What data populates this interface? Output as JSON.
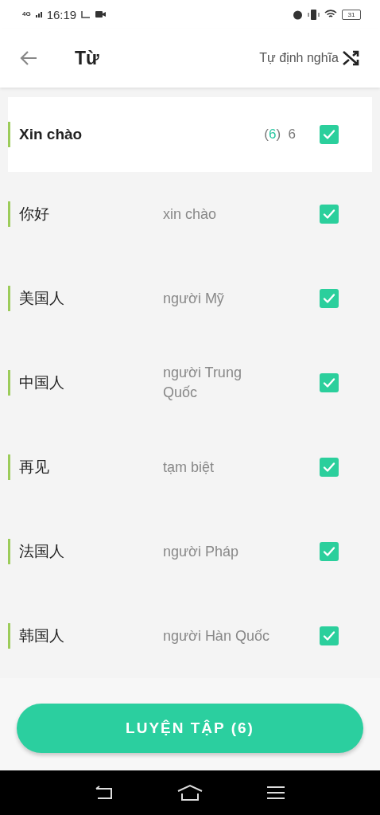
{
  "status_bar": {
    "network": "4G",
    "time": "16:19",
    "battery": "31"
  },
  "header": {
    "title": "Từ",
    "action": "Tự định nghĩa"
  },
  "group": {
    "title": "Xin chào",
    "count_open": "(",
    "selected_count": "6",
    "count_close": ")",
    "total": "6",
    "checked": true
  },
  "words": [
    {
      "word": "你好",
      "meaning": "xin chào",
      "checked": true
    },
    {
      "word": "美国人",
      "meaning": "người Mỹ",
      "checked": true
    },
    {
      "word": "中国人",
      "meaning": "người Trung Quốc",
      "checked": true
    },
    {
      "word": "再见",
      "meaning": "tạm biệt",
      "checked": true
    },
    {
      "word": "法国人",
      "meaning": "người Pháp",
      "checked": true
    },
    {
      "word": "韩国人",
      "meaning": "người Hàn Quốc",
      "checked": true
    }
  ],
  "practice_button": "LUYỆN TẬP (6)"
}
